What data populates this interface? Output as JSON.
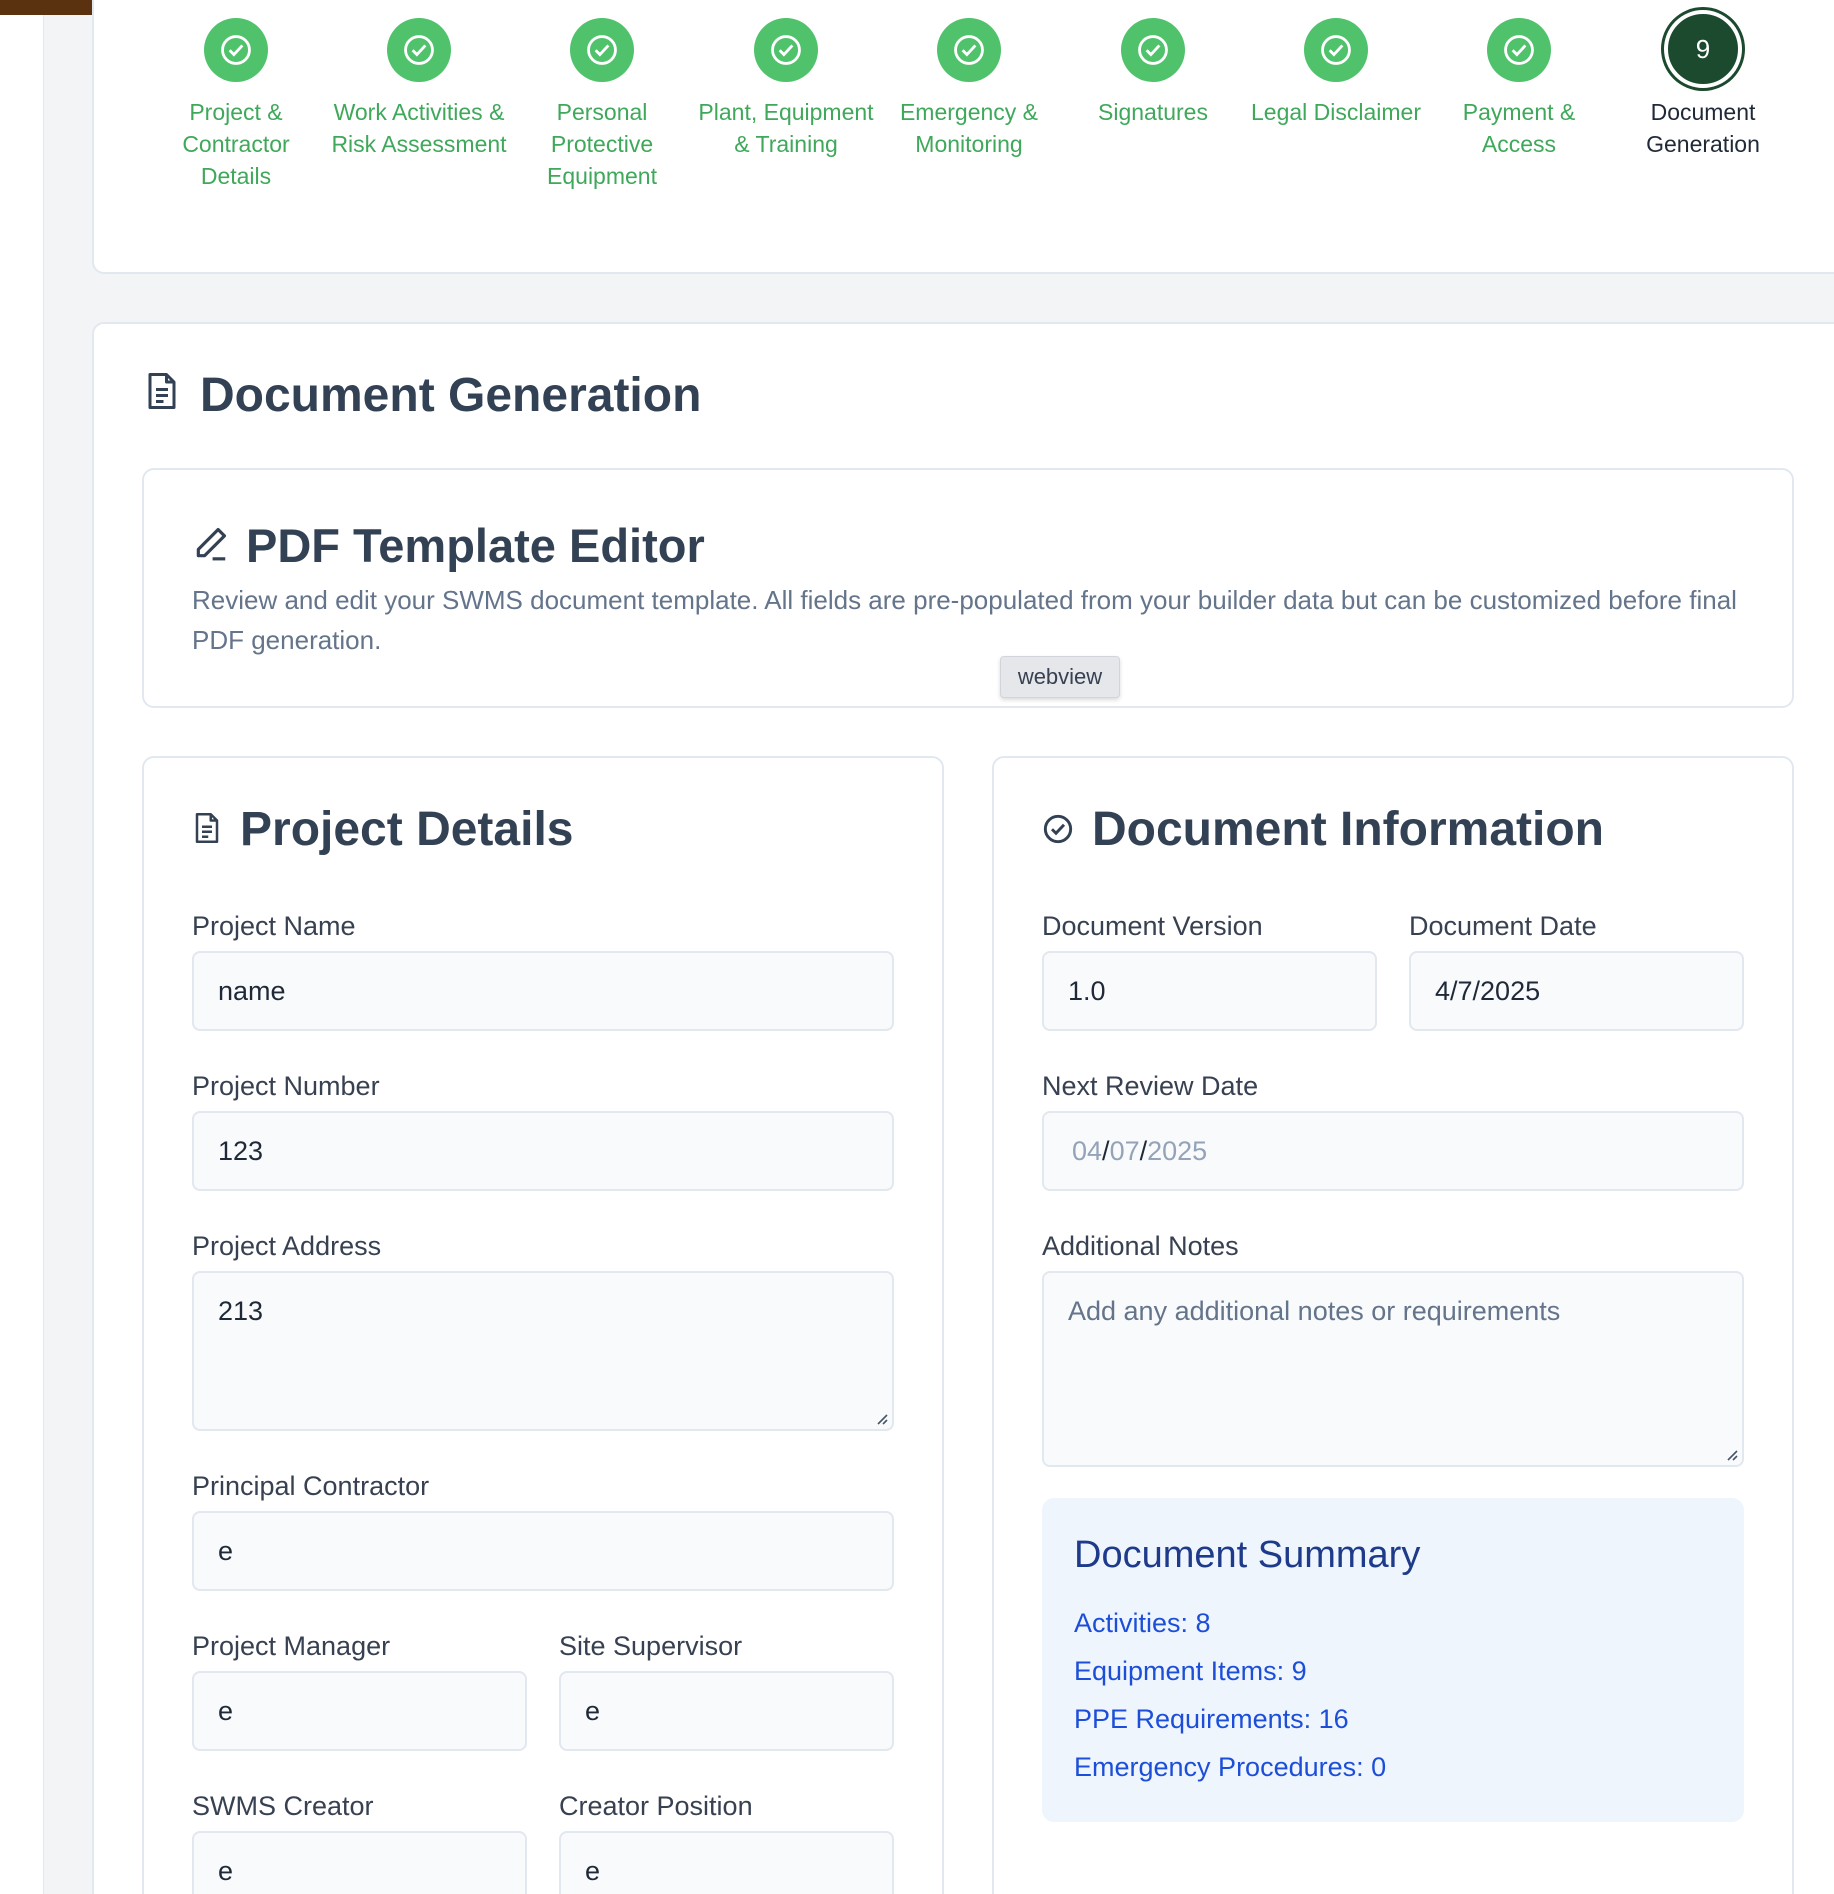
{
  "stepper": {
    "steps": [
      {
        "label": "Project & Contractor Details",
        "status": "complete"
      },
      {
        "label": "Work Activities & Risk Assessment",
        "status": "complete"
      },
      {
        "label": "Personal Protective Equipment",
        "status": "complete"
      },
      {
        "label": "Plant, Equipment & Training",
        "status": "complete"
      },
      {
        "label": "Emergency & Monitoring",
        "status": "complete"
      },
      {
        "label": "Signatures",
        "status": "complete"
      },
      {
        "label": "Legal Disclaimer",
        "status": "complete"
      },
      {
        "label": "Payment & Access",
        "status": "complete"
      },
      {
        "label": "Document Generation",
        "status": "current",
        "number": "9"
      }
    ]
  },
  "page": {
    "title": "Document Generation"
  },
  "editor": {
    "title": "PDF Template Editor",
    "description": "Review and edit your SWMS document template. All fields are pre-populated from your builder data but can be customized before final PDF generation."
  },
  "webview_tag": "webview",
  "project_details": {
    "title": "Project Details",
    "project_name_label": "Project Name",
    "project_name_value": "name",
    "project_number_label": "Project Number",
    "project_number_value": "123",
    "project_address_label": "Project Address",
    "project_address_value": "213",
    "principal_contractor_label": "Principal Contractor",
    "principal_contractor_value": "e",
    "project_manager_label": "Project Manager",
    "project_manager_value": "e",
    "site_supervisor_label": "Site Supervisor",
    "site_supervisor_value": "e",
    "swms_creator_label": "SWMS Creator",
    "swms_creator_value": "e",
    "creator_position_label": "Creator Position",
    "creator_position_value": "e"
  },
  "document_info": {
    "title": "Document Information",
    "version_label": "Document Version",
    "version_value": "1.0",
    "date_label": "Document Date",
    "date_value": "4/7/2025",
    "next_review_label": "Next Review Date",
    "next_review_day": "04",
    "next_review_month": "07",
    "next_review_year": "2025",
    "next_review_sep": "/",
    "notes_label": "Additional Notes",
    "notes_placeholder": "Add any additional notes or requirements"
  },
  "summary": {
    "title": "Document Summary",
    "activities": "Activities: 8",
    "equipment": "Equipment Items: 9",
    "ppe": "PPE Requirements: 16",
    "emergency": "Emergency Procedures: 0"
  },
  "colors": {
    "step_complete": "#4fc26b",
    "step_current": "#1c4a2e",
    "header_bar": "#5a3210",
    "summary_bg": "#eef5fd",
    "summary_text": "#1d4ed8"
  },
  "icons": {
    "step_complete": "check-circle-icon",
    "page_title": "document-icon",
    "editor": "pencil-icon",
    "project_details": "document-icon",
    "document_info": "check-circle-icon"
  }
}
